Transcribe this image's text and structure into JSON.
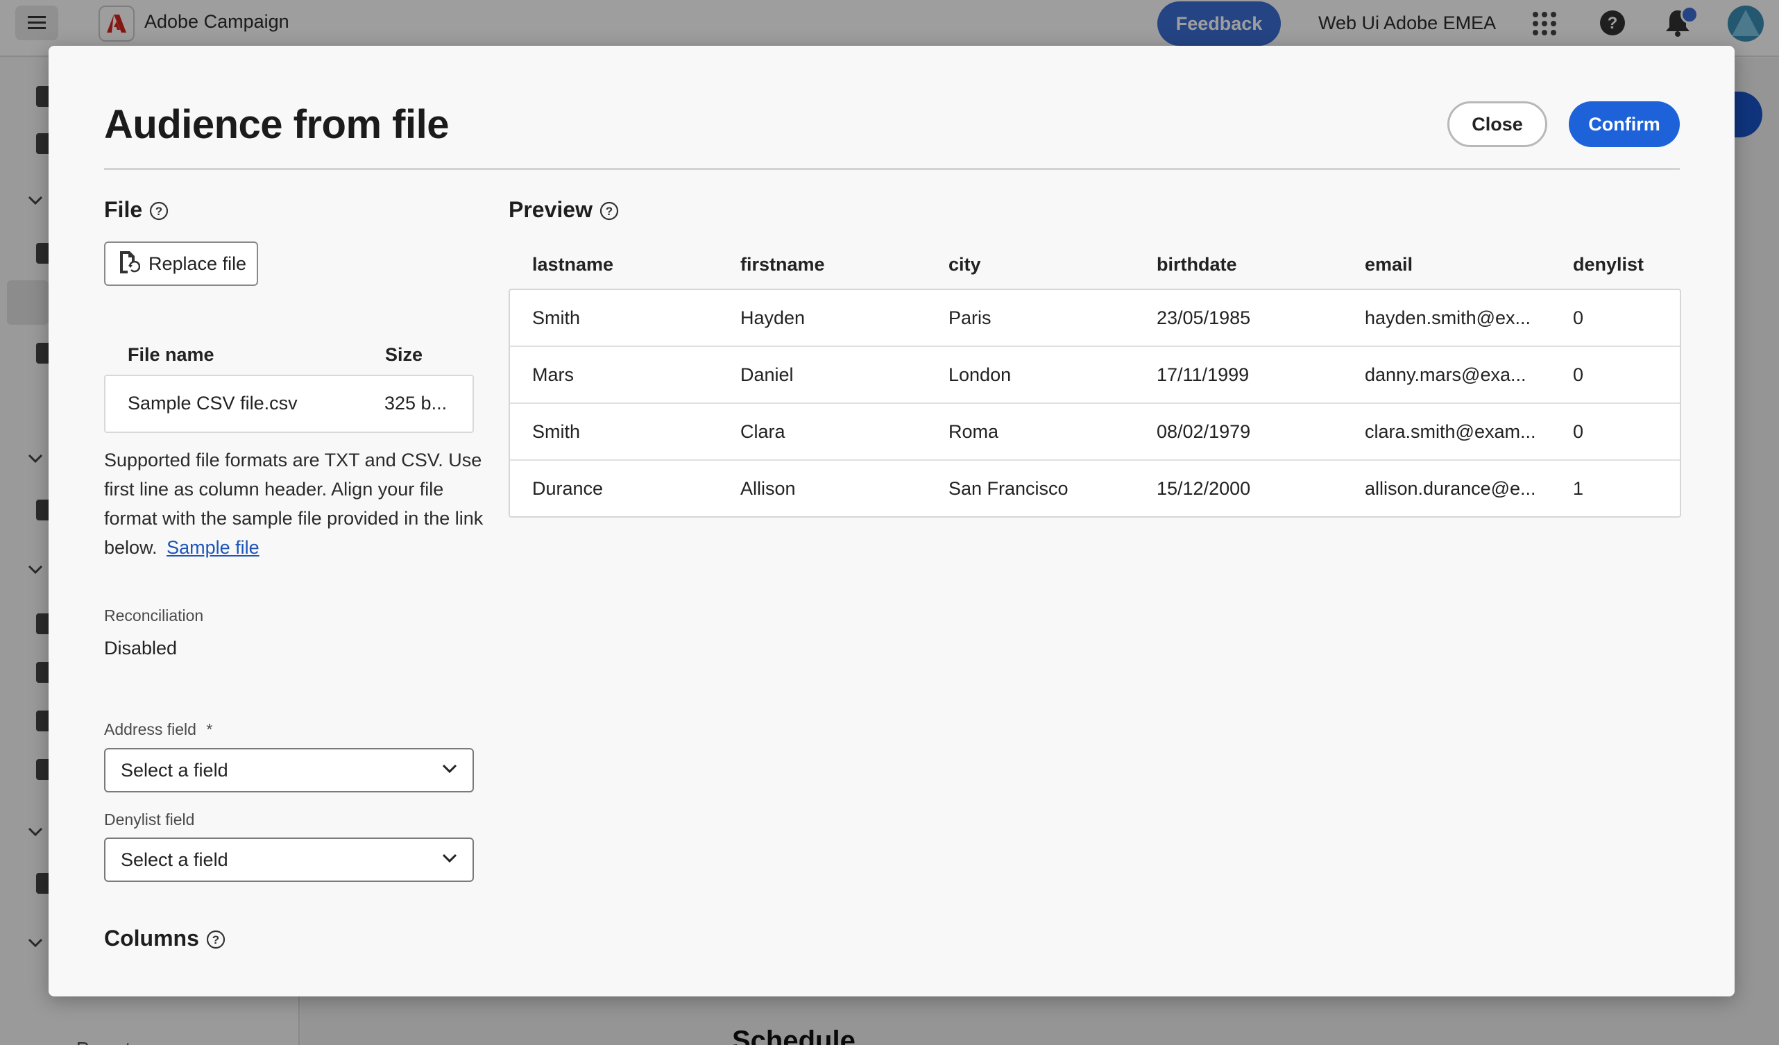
{
  "app": {
    "name": "Adobe Campaign",
    "feedback_label": "Feedback",
    "org_name": "Web Ui Adobe EMEA",
    "sidebar_reports_label": "Reports",
    "background_heading": "Schedule"
  },
  "dialog": {
    "title": "Audience from file",
    "close_label": "Close",
    "confirm_label": "Confirm",
    "file_section": {
      "title": "File",
      "replace_label": "Replace file",
      "columns": {
        "name": "File name",
        "size": "Size"
      },
      "file": {
        "name": "Sample CSV file.csv",
        "size": "325 b..."
      },
      "help_text": "Supported file formats are TXT and CSV. Use first line as column header. Align your file format with the sample file provided in the link below.",
      "sample_link": "Sample file"
    },
    "reconciliation": {
      "label": "Reconciliation",
      "value": "Disabled"
    },
    "address_field": {
      "label": "Address field",
      "required_mark": "*",
      "value": "Select a field"
    },
    "denylist_field": {
      "label": "Denylist field",
      "value": "Select a field"
    },
    "columns_title": "Columns",
    "preview": {
      "title": "Preview",
      "headers": [
        "lastname",
        "firstname",
        "city",
        "birthdate",
        "email",
        "denylist"
      ],
      "rows": [
        [
          "Smith",
          "Hayden",
          "Paris",
          "23/05/1985",
          "hayden.smith@ex...",
          "0"
        ],
        [
          "Mars",
          "Daniel",
          "London",
          "17/11/1999",
          "danny.mars@exa...",
          "0"
        ],
        [
          "Smith",
          "Clara",
          "Roma",
          "08/02/1979",
          "clara.smith@exam...",
          "0"
        ],
        [
          "Durance",
          "Allison",
          "San Francisco",
          "15/12/2000",
          "allison.durance@e...",
          "1"
        ]
      ]
    }
  },
  "colors": {
    "accent": "#1d62d8",
    "feedback": "#3d6fd6",
    "link": "#1d55b8",
    "brand_red": "#d7261f"
  },
  "icons": [
    "hamburger-icon",
    "adobe-logo-icon",
    "apps-grid-icon",
    "help-icon",
    "bell-icon",
    "file-replace-icon",
    "chevron-down-icon",
    "question-circle-icon"
  ]
}
